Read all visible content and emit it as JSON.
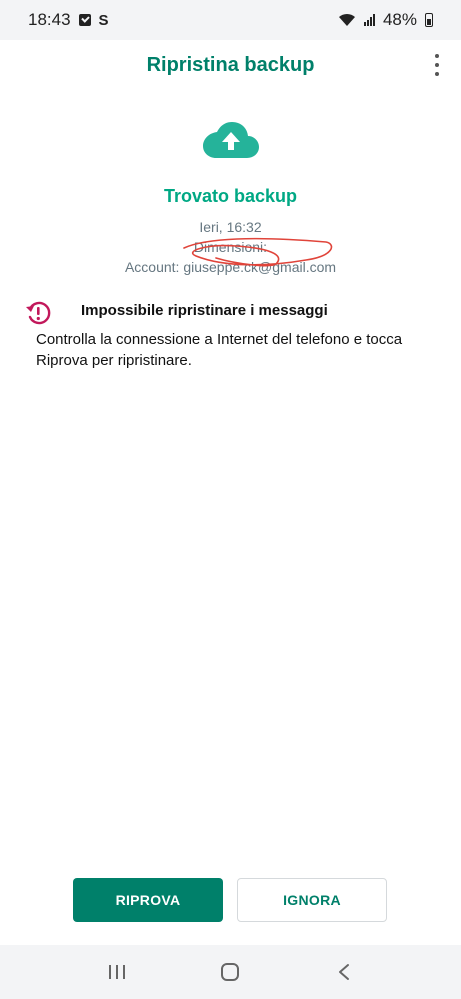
{
  "status_bar": {
    "time": "18:43",
    "battery": "48%"
  },
  "app_bar": {
    "title": "Ripristina backup"
  },
  "backup": {
    "title": "Trovato backup",
    "date": "Ieri, 16:32",
    "size_label": "Dimensioni:",
    "account": "Account: giuseppe.ck@gmail.com"
  },
  "error": {
    "title": "Impossibile ripristinare i messaggi",
    "body": "Controlla la connessione a Internet del telefono e tocca Riprova per ripristinare."
  },
  "actions": {
    "retry_label": "RIPROVA",
    "ignore_label": "IGNORA"
  },
  "colors": {
    "accent": "#00806a",
    "accent_light": "#00a884",
    "error": "#c2185b",
    "scribble": "#e0443a"
  },
  "icons": {
    "cloud": "cloud-upload-icon",
    "error": "restore-error-icon",
    "menu": "more-vert-icon"
  }
}
